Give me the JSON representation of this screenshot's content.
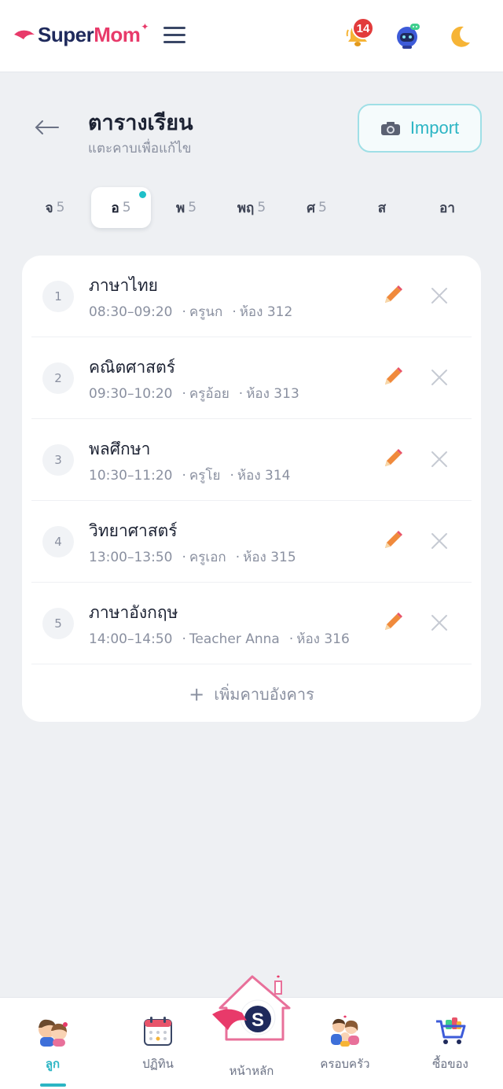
{
  "header": {
    "logo_part1": "Super",
    "logo_part2": "Mom",
    "notifications_count": "14"
  },
  "page": {
    "title": "ตารางเรียน",
    "subtitle": "แตะคาบเพื่อแก้ไข",
    "import_label": "Import"
  },
  "days": [
    {
      "name": "จ",
      "count": "5",
      "active": false
    },
    {
      "name": "อ",
      "count": "5",
      "active": true
    },
    {
      "name": "พ",
      "count": "5",
      "active": false
    },
    {
      "name": "พฤ",
      "count": "5",
      "active": false
    },
    {
      "name": "ศ",
      "count": "5",
      "active": false
    },
    {
      "name": "ส",
      "count": "",
      "active": false
    },
    {
      "name": "อา",
      "count": "",
      "active": false
    }
  ],
  "periods": [
    {
      "no": "1",
      "subject": "ภาษาไทย",
      "time": "08:30–09:20",
      "teacher": "ครูนก",
      "room": "ห้อง 312"
    },
    {
      "no": "2",
      "subject": "คณิตศาสตร์",
      "time": "09:30–10:20",
      "teacher": "ครูอ้อย",
      "room": "ห้อง 313"
    },
    {
      "no": "3",
      "subject": "พลศึกษา",
      "time": "10:30–11:20",
      "teacher": "ครูโย",
      "room": "ห้อง 314"
    },
    {
      "no": "4",
      "subject": "วิทยาศาสตร์",
      "time": "13:00–13:50",
      "teacher": "ครูเอก",
      "room": "ห้อง 315"
    },
    {
      "no": "5",
      "subject": "ภาษาอังกฤษ",
      "time": "14:00–14:50",
      "teacher": "Teacher Anna",
      "room": "ห้อง 316"
    }
  ],
  "add_period_label": "เพิ่มคาบอังคาร",
  "bottom_nav": {
    "kids": "ลูก",
    "calendar": "ปฏิทิน",
    "home": "หน้าหลัก",
    "family": "ครอบครัว",
    "shop": "ซื้อของ"
  },
  "colors": {
    "accent": "#2cb5c4",
    "brand_navy": "#1f2a5c",
    "brand_pink": "#e83a6a",
    "badge_red": "#e23b3b"
  }
}
